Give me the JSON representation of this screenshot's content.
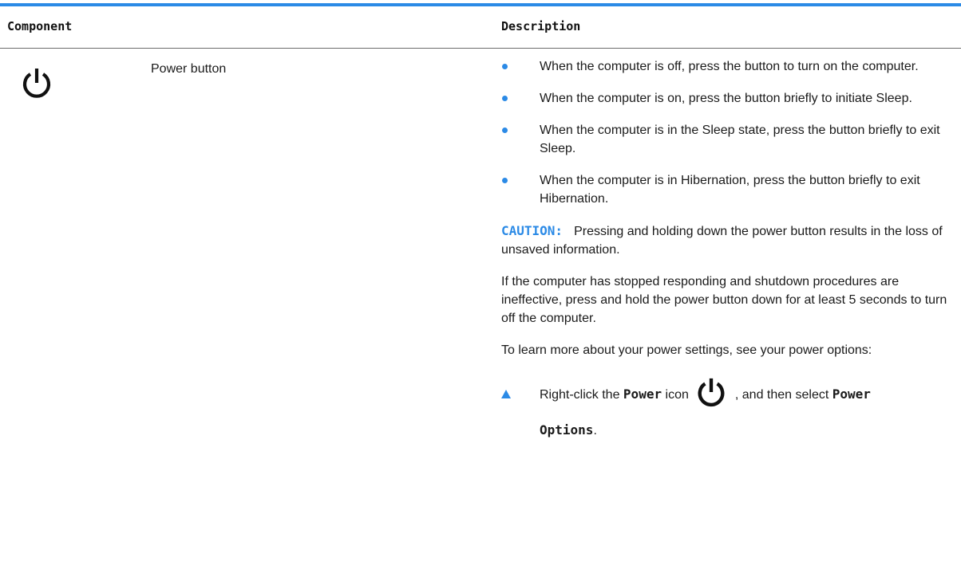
{
  "table": {
    "headers": {
      "component": "Component",
      "description": "Description"
    },
    "row": {
      "icon": "power-icon",
      "component_name": "Power button",
      "bullets": [
        "When the computer is off, press the button to turn on the computer.",
        "When the computer is on, press the button briefly to initiate Sleep.",
        "When the computer is in the Sleep state, press the button briefly to exit Sleep.",
        "When the computer is in Hibernation, press the button briefly to exit Hibernation."
      ],
      "caution": {
        "label": "CAUTION:",
        "text": "Pressing and holding down the power button results in the loss of unsaved information."
      },
      "paragraphs": [
        "If the computer has stopped responding and shutdown procedures are ineffective, press and hold the power button down for at least 5 seconds to turn off the computer.",
        "To learn more about your power settings, see your power options:"
      ],
      "step": {
        "prefix": "Right-click the ",
        "bold1": "Power",
        "middle": " icon",
        "after_icon": ", and then select ",
        "bold2": "Power",
        "bold3": "Options",
        "suffix": "."
      }
    }
  },
  "colors": {
    "accent": "#2b8ae6",
    "text": "#1a1a1a"
  }
}
